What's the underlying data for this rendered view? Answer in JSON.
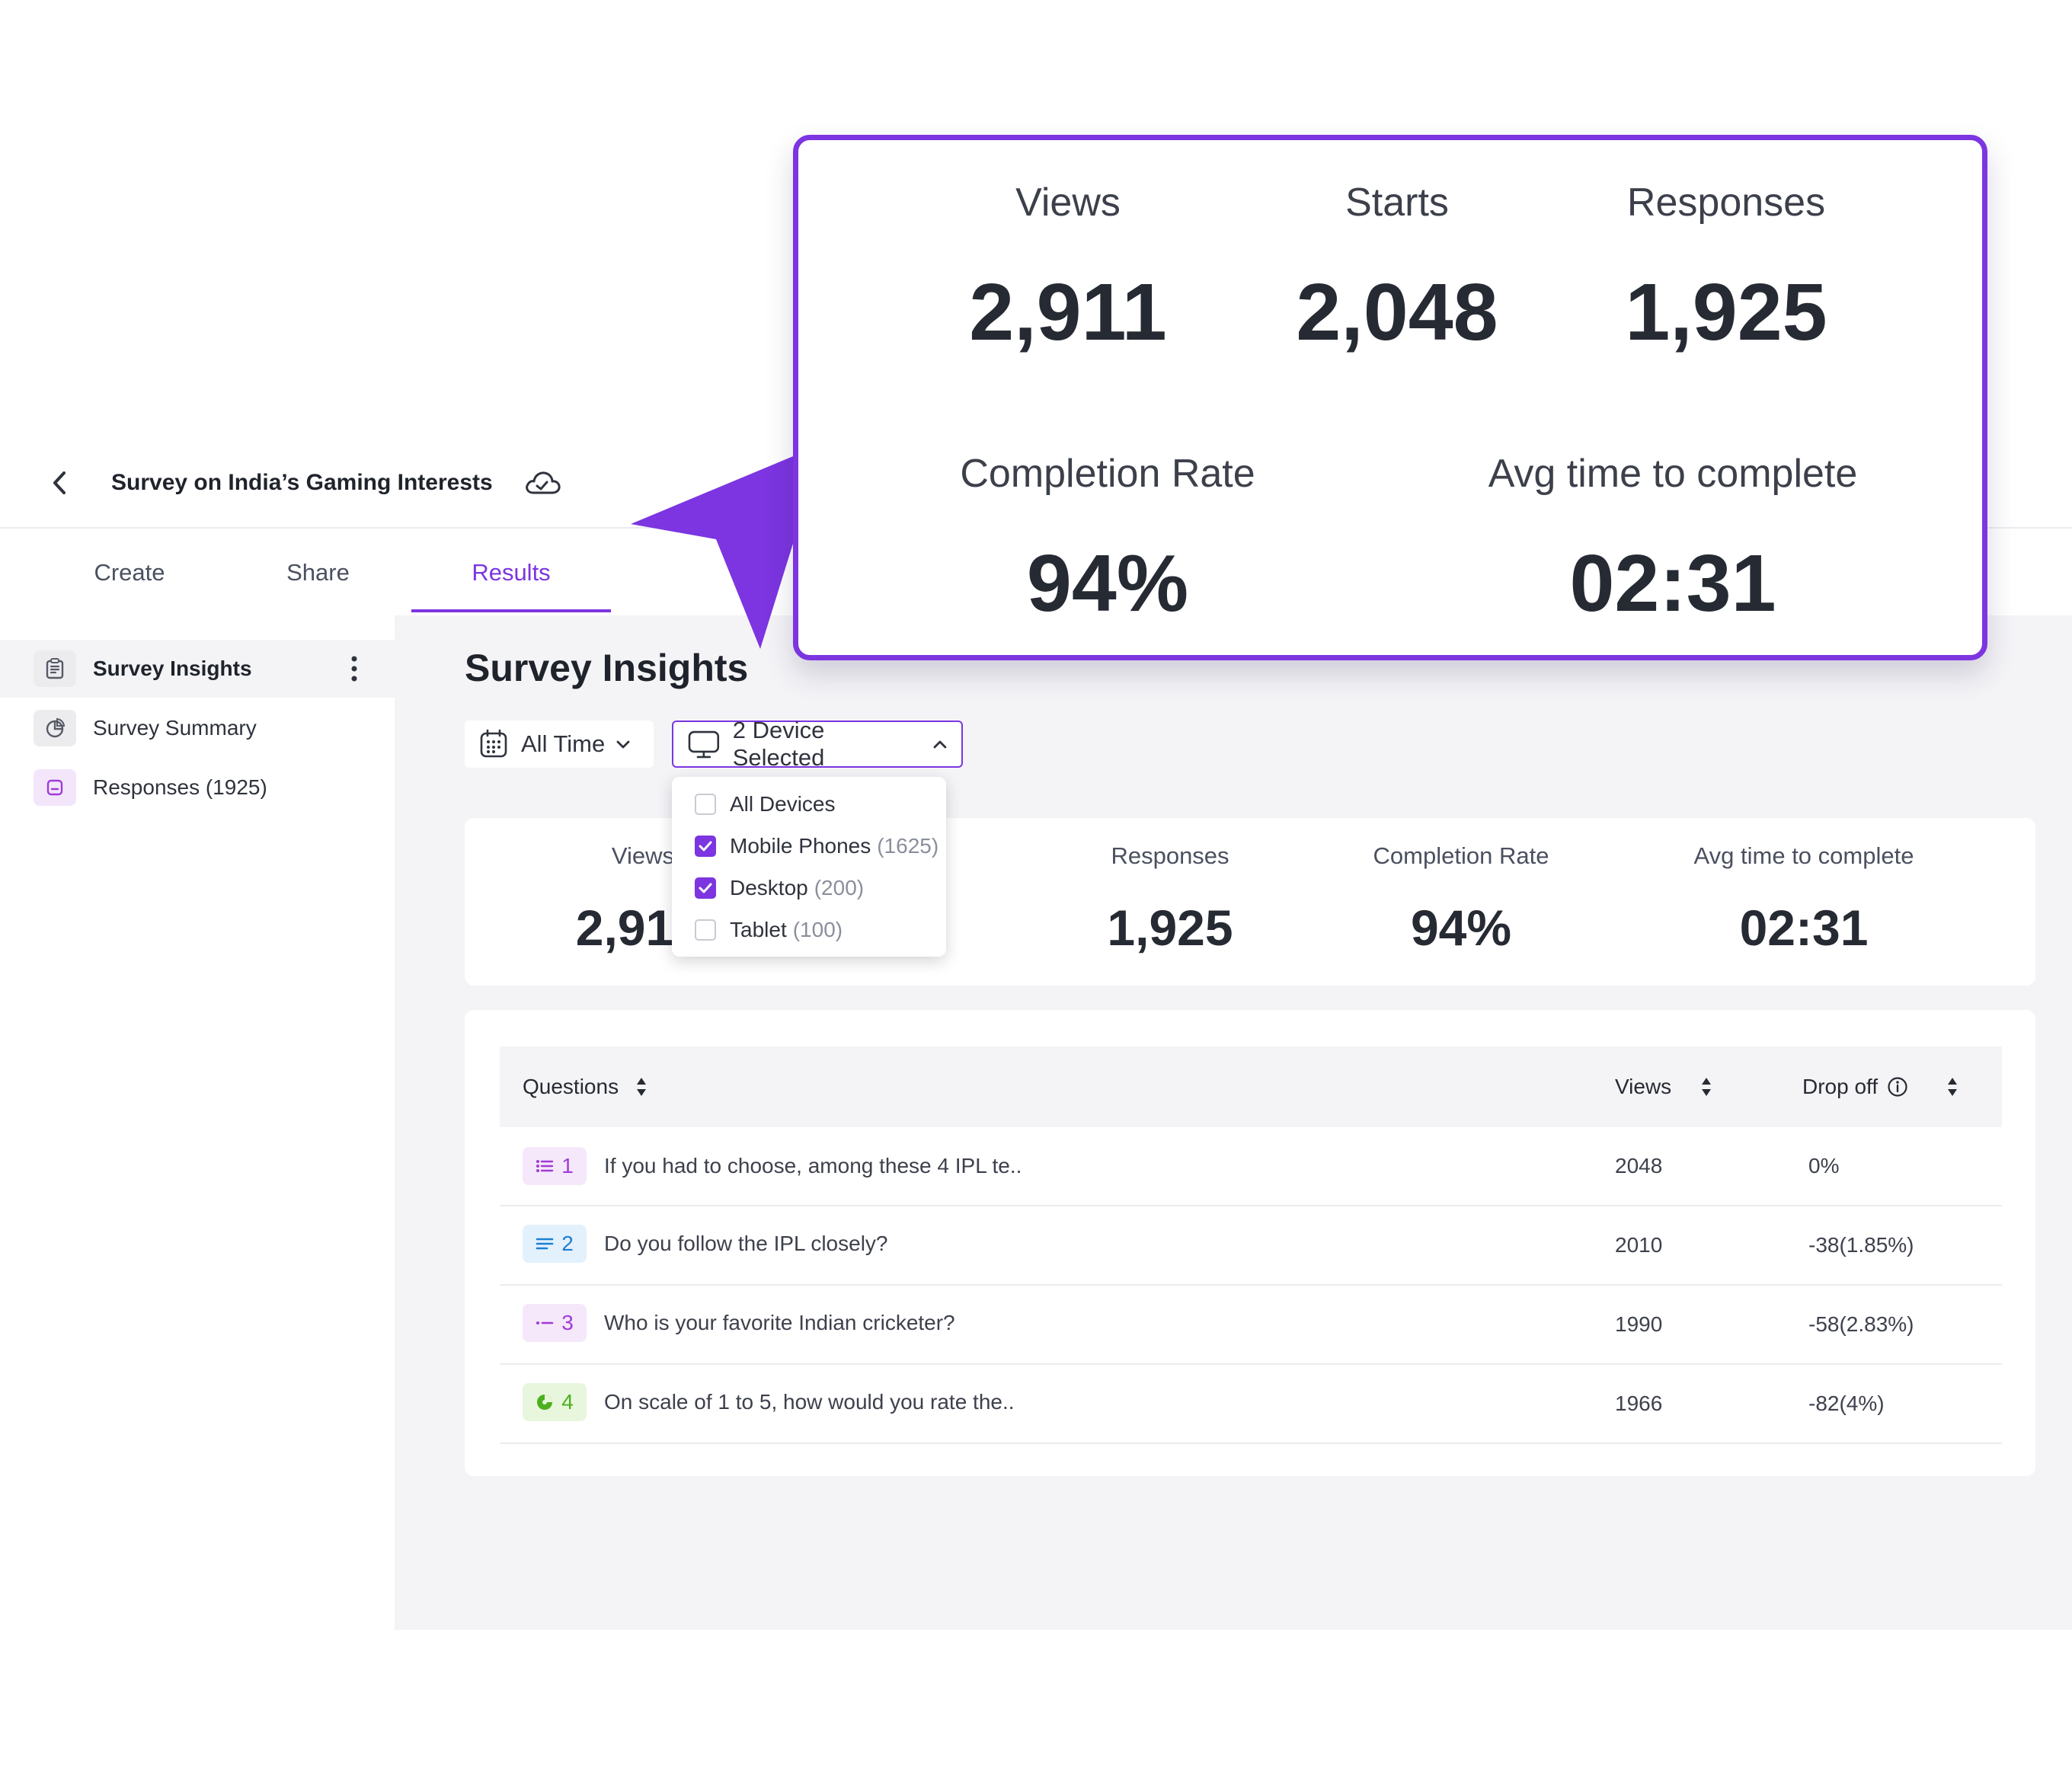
{
  "header": {
    "title": "Survey on India’s Gaming Interests"
  },
  "tabs": [
    {
      "label": "Create"
    },
    {
      "label": "Share"
    },
    {
      "label": "Results"
    }
  ],
  "sidebar": {
    "items": [
      {
        "label": "Survey Insights"
      },
      {
        "label": "Survey Summary"
      },
      {
        "label": "Responses (1925)"
      }
    ]
  },
  "main": {
    "title": "Survey Insights",
    "filters": {
      "time": "All Time",
      "device": "2 Device Selected"
    }
  },
  "device_dropdown": {
    "options": [
      {
        "label": "All Devices",
        "count": "",
        "checked": false
      },
      {
        "label": "Mobile Phones",
        "count": "(1625)",
        "checked": true
      },
      {
        "label": "Desktop",
        "count": "(200)",
        "checked": true
      },
      {
        "label": "Tablet",
        "count": "(100)",
        "checked": false
      }
    ]
  },
  "stats": [
    {
      "label": "Views",
      "value": "2,91"
    },
    {
      "label": "",
      "value": "8"
    },
    {
      "label": "Responses",
      "value": "1,925"
    },
    {
      "label": "Completion Rate",
      "value": "94%"
    },
    {
      "label": "Avg time to complete",
      "value": "02:31"
    }
  ],
  "table": {
    "headers": {
      "questions": "Questions",
      "views": "Views",
      "drop_off": "Drop off"
    },
    "rows": [
      {
        "num": "1",
        "text": "If you had to choose, among these 4 IPL te..",
        "views": "2048",
        "drop": "0%"
      },
      {
        "num": "2",
        "text": "Do you follow the IPL closely?",
        "views": "2010",
        "drop": "-38(1.85%)"
      },
      {
        "num": "3",
        "text": "Who is your favorite Indian cricketer?",
        "views": "1990",
        "drop": "-58(2.83%)"
      },
      {
        "num": "4",
        "text": "On scale of 1 to 5, how would you rate the..",
        "views": "1966",
        "drop": "-82(4%)"
      }
    ]
  },
  "callout": {
    "stats": [
      {
        "label": "Views",
        "value": "2,911"
      },
      {
        "label": "Starts",
        "value": "2,048"
      },
      {
        "label": "Responses",
        "value": "1,925"
      },
      {
        "label": "Completion Rate",
        "value": "94%"
      },
      {
        "label": "Avg time to complete",
        "value": "02:31"
      }
    ]
  },
  "colors": {
    "accent": "#7c35e0",
    "badge_q1": "#f5e8fb",
    "badge_q2": "#e3f1fd",
    "badge_q3": "#f5e8fb",
    "badge_q4": "#e7f6dc"
  },
  "icons": {
    "back": "chevron-left-icon",
    "cloud": "cloud-check-icon",
    "calendar": "calendar-icon",
    "monitor": "monitor-icon",
    "sort": "sort-icon",
    "info": "info-icon"
  }
}
